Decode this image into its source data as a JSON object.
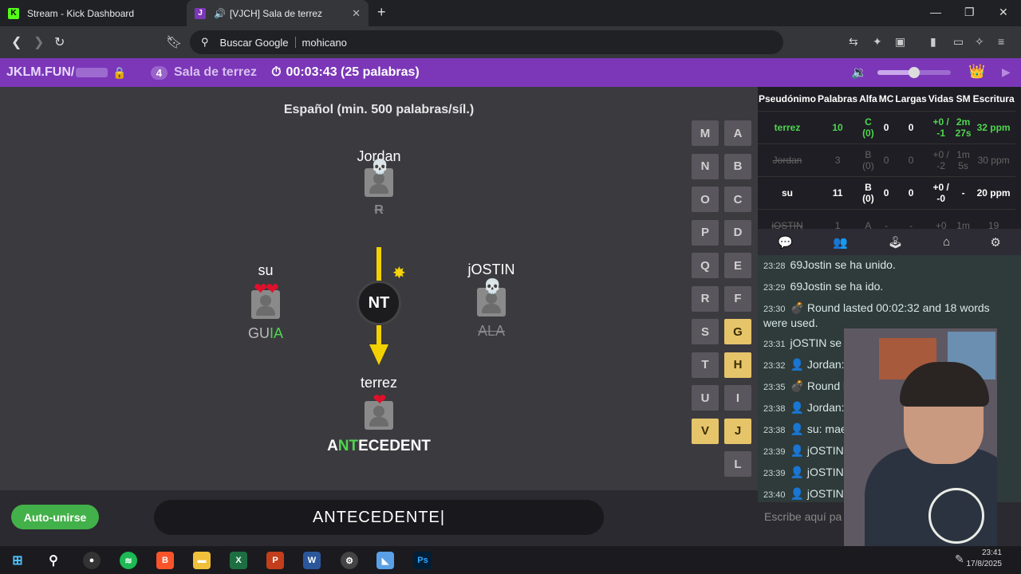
{
  "browser": {
    "tabs": [
      {
        "title": "Stream - Kick Dashboard",
        "icon": "kick-icon"
      },
      {
        "title": "[VJCH] Sala de terrez",
        "icon": "jklm-icon",
        "audio": true
      }
    ],
    "search_engine": "Buscar Google",
    "url": "mohicano"
  },
  "topbar": {
    "site": "JKLM.FUN/",
    "player_count": "4",
    "room": "Sala de terrez",
    "timer": "00:03:43 (25 palabras)",
    "volume": 0.5
  },
  "game": {
    "rule": "Español (min. 500 palabras/síl.)",
    "syllable": "NT",
    "players": [
      {
        "name": "Jordan",
        "lives": 0,
        "word": "R",
        "status": "eliminated"
      },
      {
        "name": "su",
        "lives": 2,
        "word_plain": "GU",
        "word_highlight": "IA"
      },
      {
        "name": "jOSTIN",
        "lives": 0,
        "word": "ALA",
        "status": "eliminated"
      },
      {
        "name": "terrez",
        "lives": 1,
        "word_a": "A",
        "word_hl": "NT",
        "word_b": "ECEDENT"
      }
    ],
    "letters": [
      {
        "l": "M",
        "on": false
      },
      {
        "l": "A",
        "on": false
      },
      {
        "l": "N",
        "on": false
      },
      {
        "l": "B",
        "on": false
      },
      {
        "l": "O",
        "on": false
      },
      {
        "l": "C",
        "on": false
      },
      {
        "l": "P",
        "on": false
      },
      {
        "l": "D",
        "on": false
      },
      {
        "l": "Q",
        "on": false
      },
      {
        "l": "E",
        "on": false
      },
      {
        "l": "R",
        "on": false
      },
      {
        "l": "F",
        "on": false
      },
      {
        "l": "S",
        "on": false
      },
      {
        "l": "G",
        "on": true
      },
      {
        "l": "T",
        "on": false
      },
      {
        "l": "H",
        "on": true
      },
      {
        "l": "U",
        "on": false
      },
      {
        "l": "I",
        "on": false
      },
      {
        "l": "V",
        "on": true
      },
      {
        "l": "J",
        "on": true
      },
      {
        "l": "L",
        "on": false
      }
    ],
    "autojoin_label": "Auto-unirse",
    "input_value": "ANTECEDENTE"
  },
  "stats": {
    "headers": [
      "Pseudónimo",
      "Palabras",
      "Alfa",
      "MC",
      "Largas",
      "Vidas",
      "SM",
      "Escritura"
    ],
    "rows": [
      {
        "name": "terrez",
        "palabras": "10",
        "alfa": "C (0)",
        "mc": "0",
        "largas": "0",
        "vidas": "+0 / -1",
        "sm": "2m 27s",
        "escritura": "32 ppm",
        "style": "g"
      },
      {
        "name": "Jordan",
        "palabras": "3",
        "alfa": "B (0)",
        "mc": "0",
        "largas": "0",
        "vidas": "+0 / -2",
        "sm": "1m 5s",
        "escritura": "30 ppm",
        "style": "dim"
      },
      {
        "name": "su",
        "palabras": "11",
        "alfa": "B (0)",
        "mc": "0",
        "largas": "0",
        "vidas": "+0 / -0",
        "sm": "-",
        "escritura": "20 ppm",
        "style": ""
      },
      {
        "name": "jOSTIN",
        "palabras": "1",
        "alfa": "A",
        "mc": "-",
        "largas": "-",
        "vidas": "+0",
        "sm": "1m",
        "escritura": "19",
        "style": "dim"
      }
    ]
  },
  "chat": {
    "messages": [
      {
        "time": "23:28",
        "text": "69Jostin se ha unido."
      },
      {
        "time": "23:29",
        "text": "69Jostin se ha ido."
      },
      {
        "time": "23:30",
        "text": "💣 Round lasted 00:02:32 and 18 words were used."
      },
      {
        "time": "23:31",
        "text": "jOSTIN se h"
      },
      {
        "time": "23:32",
        "text": "👤 Jordan:"
      },
      {
        "time": "23:35",
        "text": "💣 Round l were used."
      },
      {
        "time": "23:38",
        "text": "👤 Jordan:"
      },
      {
        "time": "23:38",
        "text": "👤 su: mae"
      },
      {
        "time": "23:39",
        "text": "👤 jOSTIN:"
      },
      {
        "time": "23:39",
        "text": "👤 jOSTIN:"
      },
      {
        "time": "23:40",
        "text": "👤 jOSTIN:"
      }
    ],
    "placeholder": "Escribe aquí pa"
  },
  "taskbar": {
    "time": "23:41",
    "date": "17/8/2025"
  },
  "colors": {
    "accent": "#7b37b8",
    "highlight": "#4fd64f",
    "letter_on": "#e6c46a",
    "bomb_arrow": "#f2d100"
  }
}
